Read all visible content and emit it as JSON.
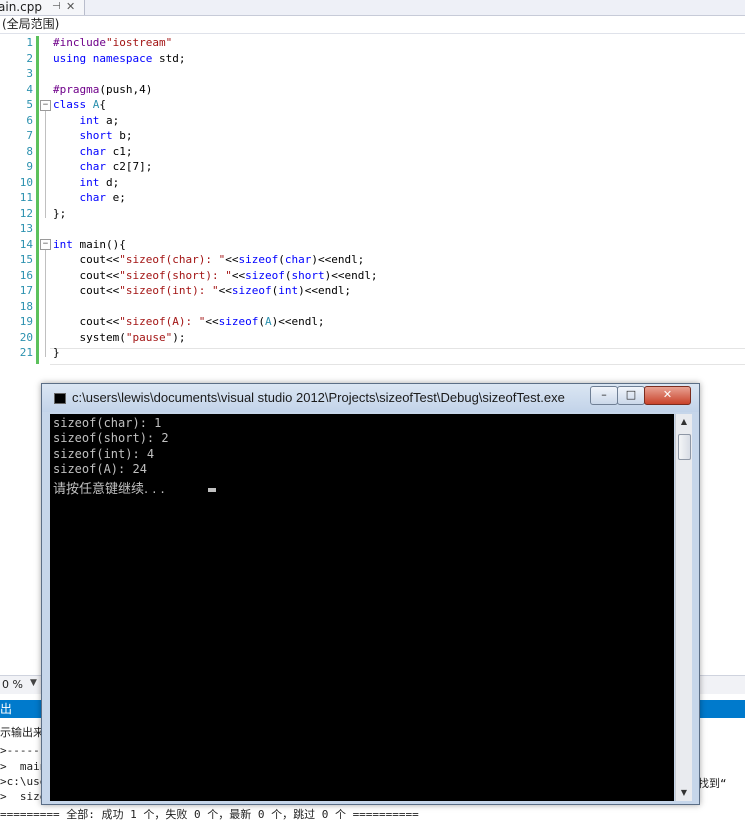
{
  "editor": {
    "tab_name": "ain.cpp",
    "tab_pin": "⊣",
    "tab_close": "✕",
    "scope": "(全局范围)",
    "line_numbers": [
      "1",
      "2",
      "3",
      "4",
      "5",
      "6",
      "7",
      "8",
      "9",
      "10",
      "11",
      "12",
      "13",
      "14",
      "15",
      "16",
      "17",
      "18",
      "19",
      "20",
      "21"
    ],
    "code": [
      "#include\"iostream\"",
      "using namespace std;",
      "",
      "#pragma(push,4)",
      "class A{",
      "    int a;",
      "    short b;",
      "    char c1;",
      "    char c2[7];",
      "    int d;",
      "    char e;",
      "};",
      "",
      "int main(){",
      "    cout<<\"sizeof(char): \"<<sizeof(char)<<endl;",
      "    cout<<\"sizeof(short): \"<<sizeof(short)<<endl;",
      "    cout<<\"sizeof(int): \"<<sizeof(int)<<endl;",
      "",
      "    cout<<\"sizeof(A): \"<<sizeof(A)<<endl;",
      "    system(\"pause\");",
      "}"
    ]
  },
  "zoom": {
    "value": "0 %",
    "dropdown": "▼"
  },
  "output": {
    "header": "出",
    "lines": [
      "示输出来",
      ">------",
      ">  main.",
      ">c:\\user",
      ">  sizeo",
      "========= 全部: 成功 1 个，失败 0 个，最新 0 个，跳过 0 个 =========="
    ],
    "right_text": "找到“"
  },
  "console": {
    "title": "c:\\users\\lewis\\documents\\visual studio 2012\\Projects\\sizeofTest\\Debug\\sizeofTest.exe",
    "buttons": {
      "minimize": "–",
      "maximize": "□",
      "close": "✕"
    },
    "lines": [
      "sizeof(char): 1",
      "sizeof(short): 2",
      "sizeof(int): 4",
      "sizeof(A): 24"
    ],
    "prompt": "请按任意键继续. . .",
    "scroll_up": "▲",
    "scroll_down": "▼"
  },
  "colors": {
    "keyword": "#0000ff",
    "string": "#a31515",
    "type": "#2b91af",
    "preprocessor": "#6f008a",
    "change_bar": "#5cc15c",
    "output_header": "#007acc",
    "console_bg": "#000000",
    "console_text": "#c0c0c0"
  }
}
